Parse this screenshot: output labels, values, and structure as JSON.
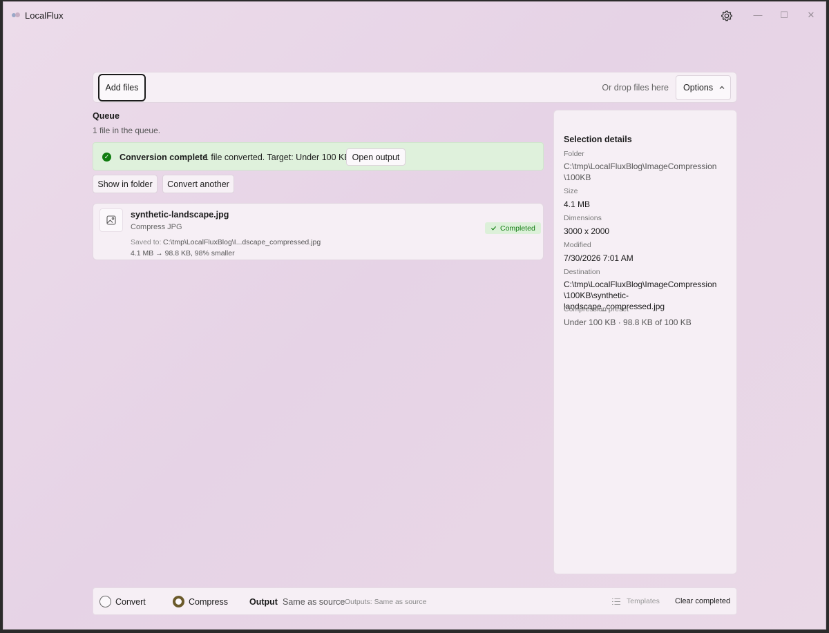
{
  "app": {
    "title": "LocalFlux"
  },
  "window_controls": {
    "minimize": "—",
    "maximize": "☐",
    "close": "✕"
  },
  "toolbar": {
    "add_files_label": "Add files",
    "drop_hint": "Or drop files here",
    "options_label": "Options",
    "options_chevron": "^"
  },
  "queue": {
    "heading": "Queue",
    "count_text": "1 file in the queue.",
    "banner": {
      "title": "Conversion complete",
      "message": "1 file converted. Target: Under 100 KB.",
      "action_label": "Open output",
      "status_color": "#107c10"
    },
    "show_in_folder_label": "Show in folder",
    "convert_another_label": "Convert another",
    "items": [
      {
        "name": "synthetic-landscape.jpg",
        "operation": "Compress JPG",
        "saved_label": "Saved to:",
        "saved_path": "C:\\tmp\\LocalFluxBlog\\I...dscape_compressed.jpg",
        "size_change": "4.1 MB → 98.8 KB, 98% smaller",
        "status": "Completed",
        "thumb_icon": "image-icon"
      }
    ]
  },
  "details": {
    "title": "Selection details",
    "folder_label": "Folder",
    "folder_line1": "C:\\tmp\\LocalFluxBlog\\ImageCompression",
    "folder_line2": "\\100KB",
    "size_label": "Size",
    "size_value": "4.1 MB",
    "dimensions_label": "Dimensions",
    "dimensions_value": "3000 x 2000",
    "modified_label": "Modified",
    "modified_value": "7/30/2026 7:01 AM",
    "destination_label": "Destination",
    "destination_line1": "C:\\tmp\\LocalFluxBlog\\ImageCompression",
    "destination_line2": "\\100KB\\synthetic-landscape_compressed.jpg",
    "preset_label": "Compression preset",
    "preset_value": "Under 100 KB · 98.8 KB of 100 KB"
  },
  "bottombar": {
    "mode_convert_label": "Convert",
    "mode_compress_label": "Compress",
    "selected_mode": "Compress",
    "output_label": "Output",
    "output_value": "Same as source",
    "outputs_hint": "Outputs: Same as source",
    "templates_label": "Templates",
    "clear_label": "Clear completed",
    "accent_color": "#6b5a2b"
  }
}
